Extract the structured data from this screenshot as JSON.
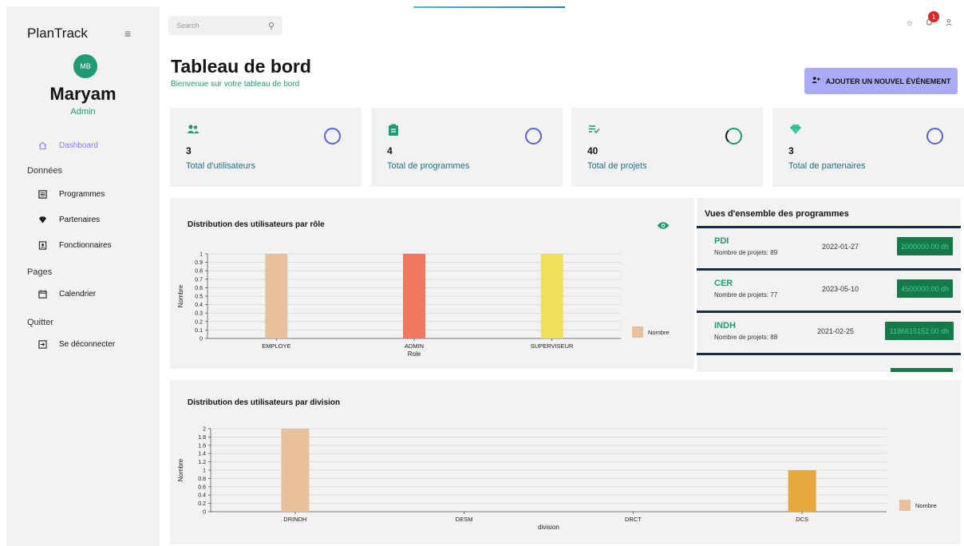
{
  "app": {
    "brand": "PlanTrack"
  },
  "user": {
    "initials": "MB",
    "name": "Maryam",
    "role": "Admin"
  },
  "nav": {
    "dashboard": "Dashboard",
    "section_data": "Données",
    "programmes": "Programmes",
    "partenaires": "Partenaires",
    "fonctionnaires": "Fonctionnaires",
    "section_pages": "Pages",
    "calendrier": "Calendrier",
    "section_quit": "Quitter",
    "logout": "Se déconnecter"
  },
  "topbar": {
    "search_placeholder": "Search",
    "notifications_count": "1"
  },
  "header": {
    "title": "Tableau de bord",
    "subtitle": "Bienvenue sur votre tableau de bord",
    "add_button": "AJOUTER UN NOUVEL ÉVÉNEMENT"
  },
  "stats": [
    {
      "value": "3",
      "label": "Total d'utilisateurs",
      "icon": "users-icon"
    },
    {
      "value": "4",
      "label": "Total de programmes",
      "icon": "clipboard-icon"
    },
    {
      "value": "40",
      "label": "Total de projets",
      "icon": "list-check-icon"
    },
    {
      "value": "3",
      "label": "Total de partenaires",
      "icon": "diamond-icon"
    }
  ],
  "programs": {
    "title": "Vues d'ensemble des programmes",
    "count_prefix": "Nombre de projets: ",
    "items": [
      {
        "name": "PDI",
        "count_text": "Nombre de projets: 89",
        "date": "2022-01-27",
        "amount": "2000000.00 dh"
      },
      {
        "name": "CER",
        "count_text": "Nombre de projets: 77",
        "date": "2023-05-10",
        "amount": "4500000.00 dh"
      },
      {
        "name": "INDH",
        "count_text": "Nombre de projets: 88",
        "date": "2021-02-25",
        "amount": "1186615152.00 dh"
      }
    ]
  },
  "colors": {
    "accent": "#1f9a75",
    "button": "#a9abf4",
    "active_nav": "#7c7ff0"
  },
  "chart_data": [
    {
      "type": "bar",
      "title": "Distribution des utilisateurs par rôle",
      "xlabel": "Role",
      "ylabel": "Nombre",
      "categories": [
        "EMPLOYE",
        "ADMIN",
        "SUPERVISEUR"
      ],
      "series": [
        {
          "name": "Nombre",
          "values": [
            1,
            1,
            1
          ]
        }
      ],
      "bar_colors": [
        "#e8c09c",
        "#f07860",
        "#f0df5a"
      ],
      "ylim": [
        0,
        1
      ],
      "yticks": [
        "0",
        "0.1",
        "0.2",
        "0.3",
        "0.4",
        "0.5",
        "0.6",
        "0.7",
        "0.8",
        "0.9",
        "1"
      ],
      "grid": true,
      "legend": "right"
    },
    {
      "type": "bar",
      "title": "Distribution des utilisateurs par division",
      "xlabel": "division",
      "ylabel": "Nombre",
      "categories": [
        "DRINDH",
        "DESM",
        "DRCT",
        "DCS"
      ],
      "series": [
        {
          "name": "Nombre",
          "values": [
            2,
            0,
            0,
            1
          ]
        }
      ],
      "bar_colors": [
        "#e8c09c",
        "#e8c09c",
        "#e8c09c",
        "#e8a840"
      ],
      "ylim": [
        0,
        2
      ],
      "yticks": [
        "0",
        "0.2",
        "0.4",
        "0.6",
        "0.8",
        "1",
        "1.2",
        "1.4",
        "1.6",
        "1.8",
        "2"
      ],
      "grid": true,
      "legend": "right"
    }
  ]
}
